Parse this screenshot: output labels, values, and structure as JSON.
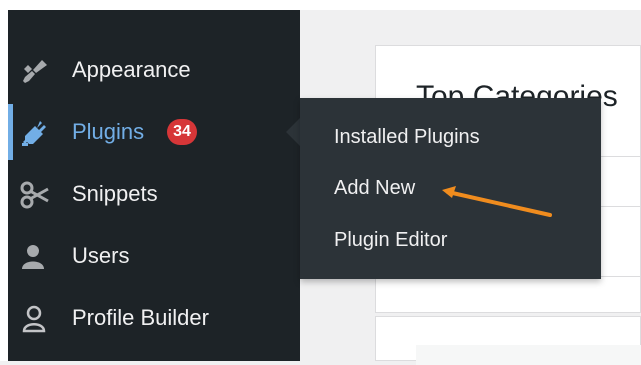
{
  "sidebar": {
    "items": [
      {
        "label": "Appearance",
        "icon": "paintbrush-icon"
      },
      {
        "label": "Plugins",
        "icon": "plugin-plug-icon",
        "badge": "34",
        "active": true
      },
      {
        "label": "Snippets",
        "icon": "scissors-icon"
      },
      {
        "label": "Users",
        "icon": "users-icon"
      },
      {
        "label": "Profile Builder",
        "icon": "person-outline-icon"
      }
    ]
  },
  "submenu": {
    "items": [
      {
        "label": "Installed Plugins"
      },
      {
        "label": "Add New"
      },
      {
        "label": "Plugin Editor"
      }
    ]
  },
  "main": {
    "panel_title": "Top Categories"
  },
  "colors": {
    "sidebar_bg": "#1d2327",
    "submenu_bg": "#2c3338",
    "active_accent": "#72aee6",
    "badge": "#d63638",
    "annotation_arrow": "#f08c1e"
  }
}
